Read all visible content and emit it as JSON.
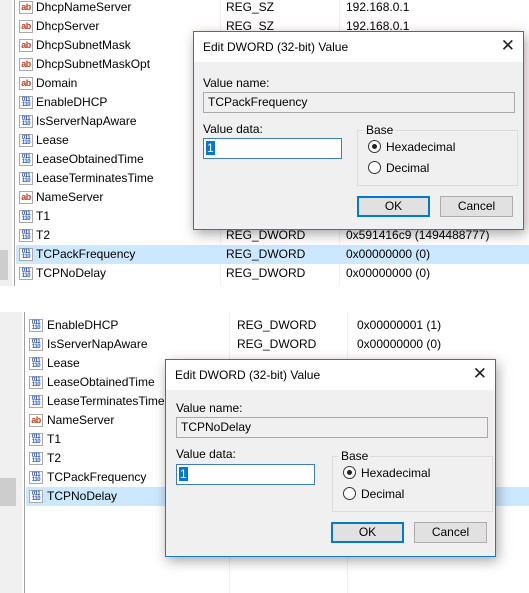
{
  "top_list": {
    "rows": [
      {
        "name": "DhcpNameServer",
        "type": "REG_SZ",
        "data": "192.168.0.1",
        "icon": "string-value-icon",
        "kind": "sz"
      },
      {
        "name": "DhcpServer",
        "type": "REG_SZ",
        "data": "192.168.0.1",
        "icon": "string-value-icon",
        "kind": "sz"
      },
      {
        "name": "DhcpSubnetMask",
        "type": "",
        "data": "",
        "icon": "string-value-icon",
        "kind": "sz"
      },
      {
        "name": "DhcpSubnetMaskOpt",
        "type": "",
        "data": "",
        "icon": "string-value-icon",
        "kind": "sz"
      },
      {
        "name": "Domain",
        "type": "",
        "data": "",
        "icon": "string-value-icon",
        "kind": "sz"
      },
      {
        "name": "EnableDHCP",
        "type": "",
        "data": "",
        "icon": "binary-value-icon",
        "kind": "dw"
      },
      {
        "name": "IsServerNapAware",
        "type": "",
        "data": "",
        "icon": "binary-value-icon",
        "kind": "dw"
      },
      {
        "name": "Lease",
        "type": "",
        "data": "",
        "icon": "binary-value-icon",
        "kind": "dw"
      },
      {
        "name": "LeaseObtainedTime",
        "type": "",
        "data": "",
        "icon": "binary-value-icon",
        "kind": "dw"
      },
      {
        "name": "LeaseTerminatesTime",
        "type": "",
        "data": "",
        "icon": "binary-value-icon",
        "kind": "dw"
      },
      {
        "name": "NameServer",
        "type": "",
        "data": "",
        "icon": "string-value-icon",
        "kind": "sz"
      },
      {
        "name": "T1",
        "type": "",
        "data": "",
        "icon": "binary-value-icon",
        "kind": "dw"
      },
      {
        "name": "T2",
        "type": "REG_DWORD",
        "data": "0x591416c9 (1494488777)",
        "icon": "binary-value-icon",
        "kind": "dw"
      },
      {
        "name": "TCPackFrequency",
        "type": "REG_DWORD",
        "data": "0x00000000 (0)",
        "icon": "binary-value-icon",
        "kind": "dw",
        "selected": true
      },
      {
        "name": "TCPNoDelay",
        "type": "REG_DWORD",
        "data": "0x00000000 (0)",
        "icon": "binary-value-icon",
        "kind": "dw"
      }
    ]
  },
  "top_dialog": {
    "title": "Edit DWORD (32-bit) Value",
    "close_glyph": "✕",
    "value_name_label": "Value name:",
    "value_name": "TCPackFrequency",
    "value_data_label": "Value data:",
    "value_data": "1",
    "base_label": "Base",
    "hex_label": "Hexadecimal",
    "dec_label": "Decimal",
    "base_selected": "Hexadecimal",
    "ok_label": "OK",
    "cancel_label": "Cancel"
  },
  "bottom_list": {
    "rows": [
      {
        "name": "EnableDHCP",
        "type": "REG_DWORD",
        "data": "0x00000001 (1)",
        "icon": "binary-value-icon",
        "kind": "dw"
      },
      {
        "name": "IsServerNapAware",
        "type": "REG_DWORD",
        "data": "0x00000000 (0)",
        "icon": "binary-value-icon",
        "kind": "dw"
      },
      {
        "name": "Lease",
        "type": "",
        "data": "",
        "icon": "binary-value-icon",
        "kind": "dw"
      },
      {
        "name": "LeaseObtainedTime",
        "type": "",
        "data": "",
        "icon": "binary-value-icon",
        "kind": "dw"
      },
      {
        "name": "LeaseTerminatesTime",
        "type": "",
        "data": "",
        "icon": "binary-value-icon",
        "kind": "dw"
      },
      {
        "name": "NameServer",
        "type": "",
        "data": "",
        "icon": "string-value-icon",
        "kind": "sz"
      },
      {
        "name": "T1",
        "type": "",
        "data": "",
        "icon": "binary-value-icon",
        "kind": "dw"
      },
      {
        "name": "T2",
        "type": "",
        "data": "",
        "icon": "binary-value-icon",
        "kind": "dw"
      },
      {
        "name": "TCPackFrequency",
        "type": "",
        "data": "",
        "icon": "binary-value-icon",
        "kind": "dw"
      },
      {
        "name": "TCPNoDelay",
        "type": "",
        "data": "",
        "icon": "binary-value-icon",
        "kind": "dw",
        "selected": true
      }
    ]
  },
  "bottom_dialog": {
    "title": "Edit DWORD (32-bit) Value",
    "close_glyph": "✕",
    "value_name_label": "Value name:",
    "value_name": "TCPNoDelay",
    "value_data_label": "Value data:",
    "value_data": "1",
    "base_label": "Base",
    "hex_label": "Hexadecimal",
    "dec_label": "Decimal",
    "base_selected": "Hexadecimal",
    "ok_label": "OK",
    "cancel_label": "Cancel"
  },
  "icons": {
    "sz_glyph": "ab",
    "dw_glyph": "011\n110"
  },
  "colors": {
    "selection": "#cce8ff",
    "accent": "#0078d7",
    "dialog_border": "#1979ca"
  }
}
